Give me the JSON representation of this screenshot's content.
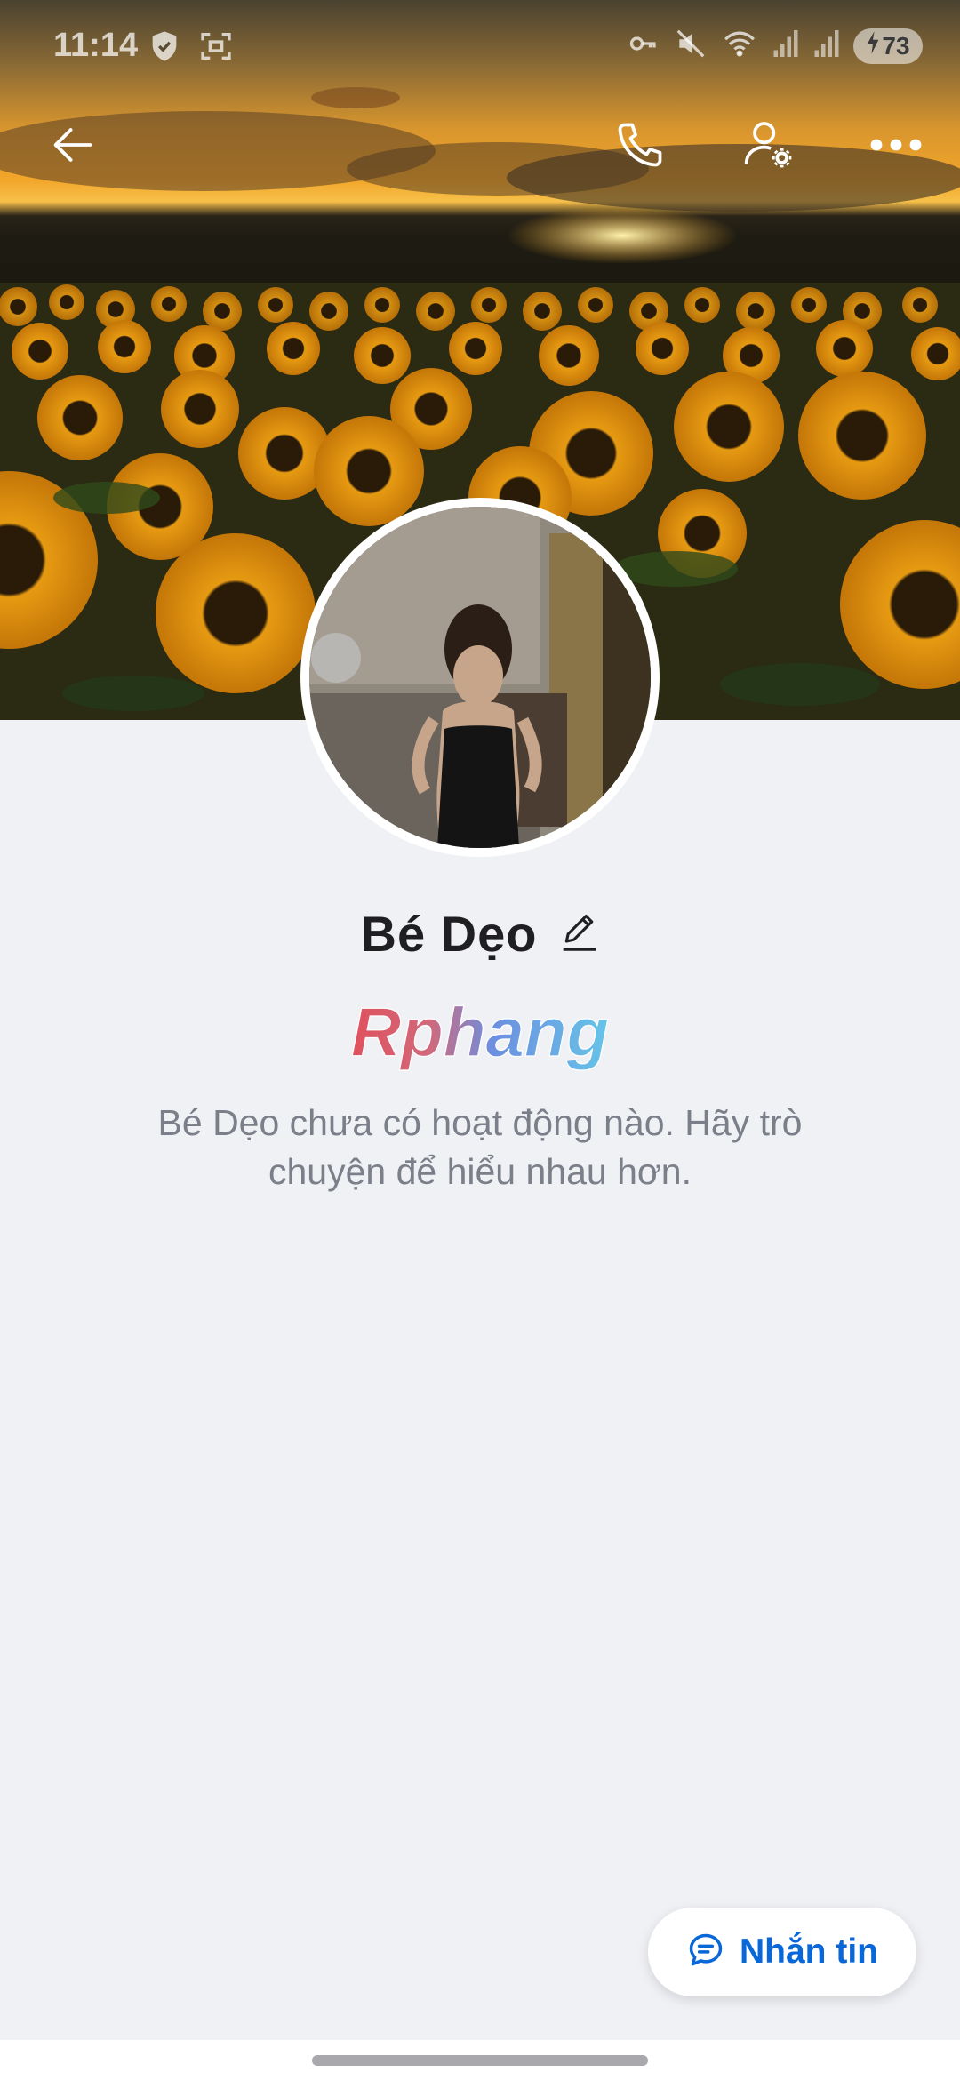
{
  "status_bar": {
    "time": "11:14",
    "battery": "73",
    "icons": [
      "shield-check-icon",
      "screenshot-icon",
      "key-icon",
      "mute-icon",
      "wifi-icon",
      "signal-icon",
      "signal-icon",
      "battery-charging-icon"
    ]
  },
  "toolbar": {
    "back_icon": "arrow-left-icon",
    "call_icon": "phone-icon",
    "settings_icon": "user-settings-icon",
    "more_icon": "more-horizontal-icon"
  },
  "profile": {
    "name": "Bé Dẹo",
    "edit_icon": "pencil-icon"
  },
  "watermark": "Rphang",
  "empty_state": {
    "text": "Bé Dẹo chưa có hoạt động nào. Hãy trò chuyện để hiểu nhau hơn."
  },
  "message_button": {
    "label": "Nhắn tin",
    "icon": "chat-bubble-icon"
  },
  "colors": {
    "accent": "#0a67d8",
    "background": "#f0f1f5"
  }
}
